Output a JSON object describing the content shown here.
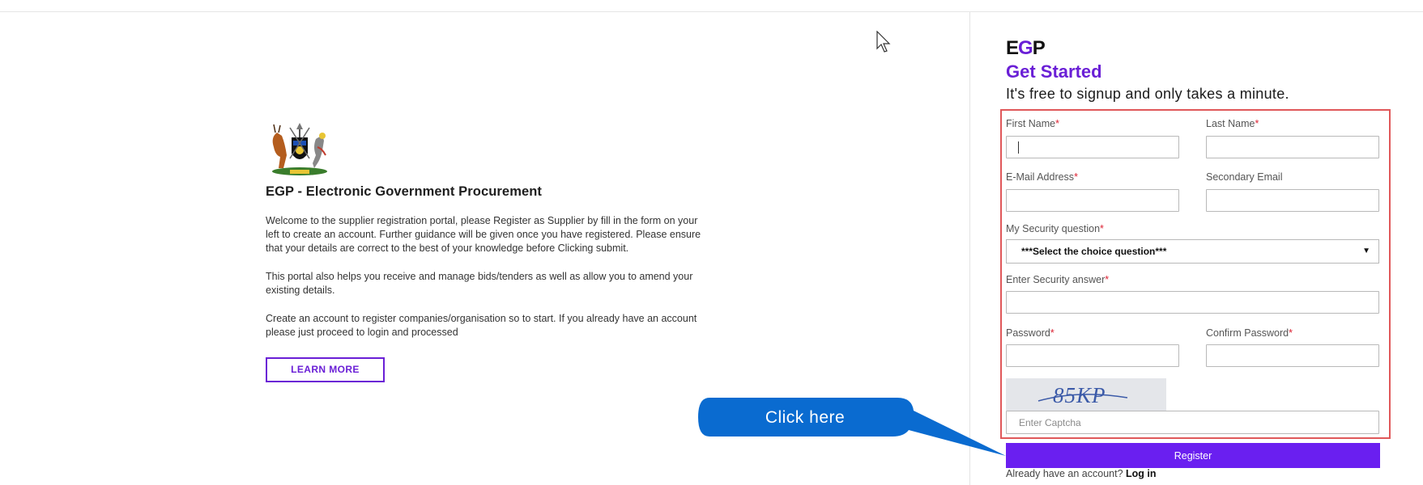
{
  "info": {
    "title": "EGP - Electronic Government Procurement",
    "paragraphs": [
      "Welcome to the supplier registration portal, please Register as Supplier by fill in the form on your left to create an account. Further guidance will be given once you have registered. Please ensure that your details are correct to the best of your knowledge before Clicking submit.",
      "This portal also helps you receive and manage bids/tenders as well as allow you to amend your existing details.",
      "Create an account to register companies/organisation so to start. If you already have an account please just proceed to login and processed"
    ],
    "learn_more_label": "LEARN MORE"
  },
  "callout": {
    "text": "Click here",
    "color": "#0a6bd0"
  },
  "form": {
    "brand_e": "E",
    "brand_g": "G",
    "brand_p": "P",
    "heading": "Get Started",
    "subtitle": "It's free to signup and only takes a minute.",
    "required_mark": "*",
    "fields": {
      "first_name": "First Name",
      "last_name": "Last Name",
      "email": "E-Mail Address",
      "secondary_email": "Secondary Email",
      "security_question": "My Security question",
      "security_answer": "Enter Security answer",
      "password": "Password",
      "confirm_password": "Confirm Password"
    },
    "security_select_value": "***Select the choice question***",
    "captcha_text": "85KP",
    "captcha_placeholder": "Enter Captcha",
    "register_label": "Register",
    "login_prompt": "Already have an account?",
    "login_link": "Log in"
  },
  "colors": {
    "accent": "#6a1fd6",
    "highlight_border": "#e0585a",
    "register_bg": "#6a1ff0"
  },
  "icons": {
    "cursor": "mouse-pointer-icon",
    "select_arrow": "caret-down-icon",
    "coat": "coat-of-arms-icon"
  }
}
